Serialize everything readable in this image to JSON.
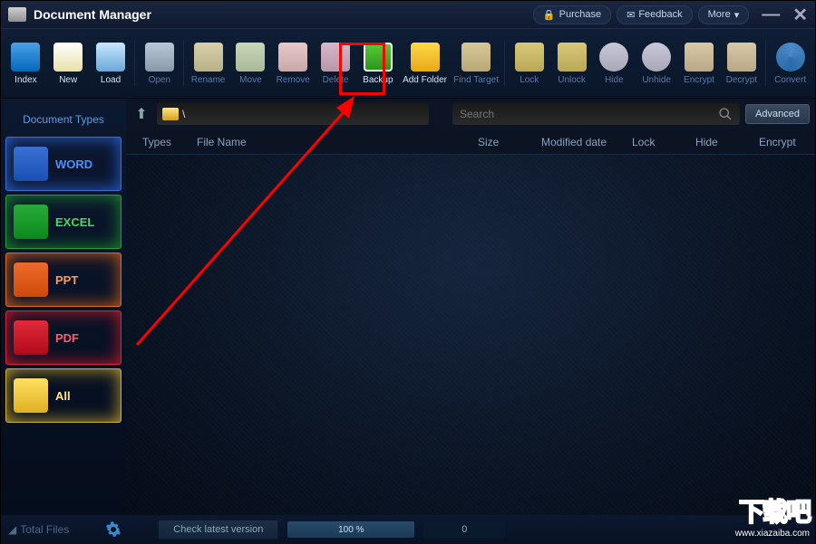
{
  "title": "Document Manager",
  "topButtons": {
    "purchase": "Purchase",
    "feedback": "Feedback",
    "more": "More"
  },
  "toolbar": {
    "index": "Index",
    "new": "New",
    "load": "Load",
    "open": "Open",
    "rename": "Rename",
    "move": "Move",
    "remove": "Remove",
    "delete": "Delete",
    "backup": "Backup",
    "addFolder": "Add Folder",
    "findTarget": "Find Target",
    "lock": "Lock",
    "unlock": "Unlock",
    "hide": "Hide",
    "unhide": "Unhide",
    "encrypt": "Encrypt",
    "decrypt": "Decrypt",
    "convert": "Convert"
  },
  "sidebar": {
    "title": "Document Types",
    "word": "WORD",
    "excel": "EXCEL",
    "ppt": "PPT",
    "pdf": "PDF",
    "all": "All"
  },
  "path": "\\",
  "search": {
    "placeholder": "Search"
  },
  "advanced": "Advanced",
  "columns": {
    "types": "Types",
    "fileName": "File Name",
    "size": "Size",
    "modified": "Modified date",
    "lock": "Lock",
    "hide": "Hide",
    "encrypt": "Encrypt"
  },
  "status": {
    "totalFiles": "Total Files",
    "checkVersion": "Check latest version",
    "progress": "100 %",
    "count": "0"
  },
  "watermark": {
    "text": "下载吧",
    "url": "www.xiazaiba.com"
  }
}
